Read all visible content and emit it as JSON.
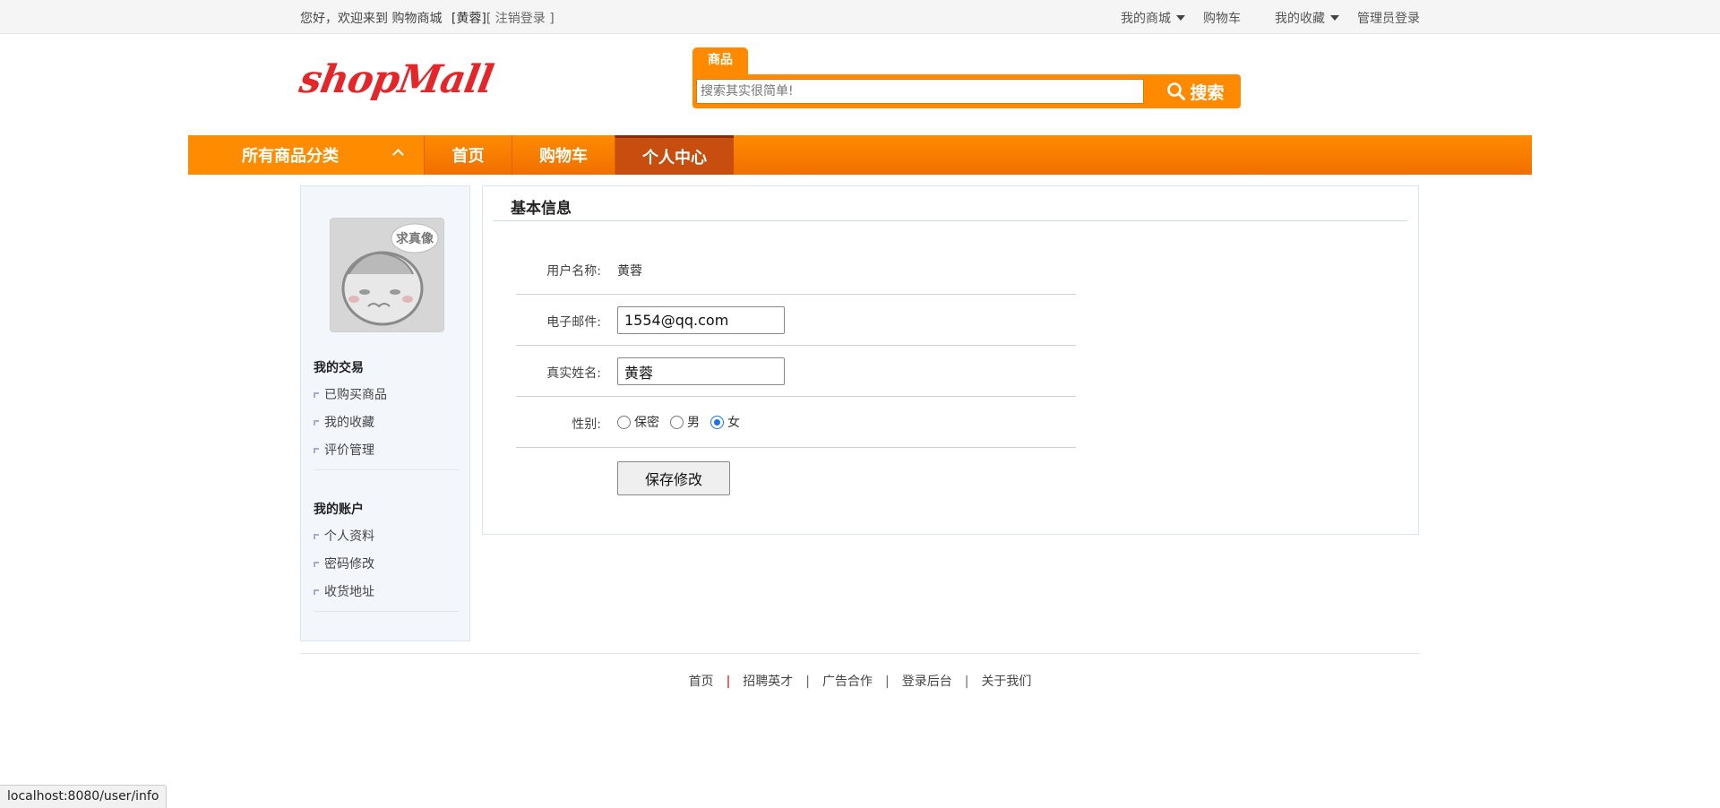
{
  "topbar": {
    "welcome": "您好，欢迎来到 购物商城",
    "username_bracket": "[黄蓉]",
    "logout": "[ 注销登录 ]",
    "menu": [
      {
        "label": "我的商城",
        "dropdown": true
      },
      {
        "label": "购物车",
        "dropdown": false
      },
      {
        "label": "我的收藏",
        "dropdown": true
      },
      {
        "label": "管理员登录",
        "dropdown": false
      }
    ]
  },
  "header": {
    "logo": "shopMall",
    "search_tab": "商品",
    "search_placeholder": "搜索其实很简单!",
    "search_button": "搜索"
  },
  "nav": {
    "all_categories": "所有商品分类",
    "items": [
      "首页",
      "购物车",
      "个人中心"
    ],
    "active": "个人中心"
  },
  "sidebar": {
    "avatar_text": "求真像",
    "sections": [
      {
        "title": "我的交易",
        "links": [
          "已购买商品",
          "我的收藏",
          "评价管理"
        ]
      },
      {
        "title": "我的账户",
        "links": [
          "个人资料",
          "密码修改",
          "收货地址"
        ]
      }
    ]
  },
  "main": {
    "title": "基本信息",
    "username_label": "用户名称:",
    "username_value": "黄蓉",
    "email_label": "电子邮件:",
    "email_value": "1554@qq.com",
    "realname_label": "真实姓名:",
    "realname_value": "黄蓉",
    "gender_label": "性别:",
    "gender_options": [
      "保密",
      "男",
      "女"
    ],
    "gender_selected": "女",
    "save_button": "保存修改"
  },
  "footer": {
    "links": [
      "首页",
      "招聘英才",
      "广告合作",
      "登录后台",
      "关于我们"
    ]
  },
  "status_url": "localhost:8080/user/info",
  "colors": {
    "accent": "#ff8a00",
    "nav_active": "#c84e10",
    "logo": "#e3262a"
  }
}
